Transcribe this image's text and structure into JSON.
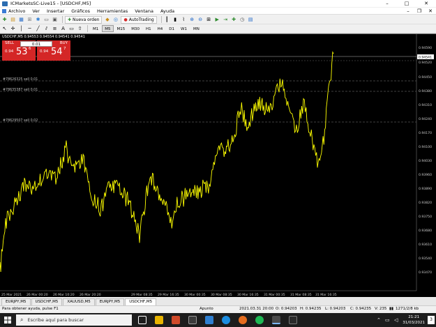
{
  "window": {
    "title": "ICMarketsSC-Live15 - [USDCHF,M5]"
  },
  "menu": {
    "items": [
      "Archivo",
      "Ver",
      "Insertar",
      "Gráficos",
      "Herramientas",
      "Ventana",
      "Ayuda"
    ]
  },
  "toolbar": {
    "new_order": "Nueva orden",
    "autotrading": "AutoTrading"
  },
  "timeframes": [
    "M1",
    "M5",
    "M15",
    "M30",
    "H1",
    "H4",
    "D1",
    "W1",
    "MN"
  ],
  "chart": {
    "header": "USDCHF,M5  0.94553 0.94554 0.94541 0.94541",
    "colors": {
      "bg": "#000000",
      "line": "#ffff00",
      "bid": "#ffffff",
      "order": "#555555"
    },
    "orders": [
      "#78626325 sell 0.01",
      "#78635387 sell 0.01",
      "#78629507 sell 0.02"
    ],
    "price_labels": [
      "0.94590",
      "0.94541",
      "0.94520",
      "0.94450",
      "0.94380",
      "0.94310",
      "0.94240",
      "0.94170",
      "0.94100",
      "0.94030",
      "0.93960",
      "0.93890",
      "0.93820",
      "0.93750",
      "0.93680",
      "0.93610",
      "0.93540",
      "0.93470"
    ],
    "time_labels": [
      "25 Mar 2021",
      "26 Mar 00:20",
      "26 Mar 10:20",
      "26 Mar 20:20",
      "29 Mar 08:35",
      "29 Mar 16:35",
      "30 Mar 00:35",
      "30 Mar 08:35",
      "30 Mar 16:35",
      "31 Mar 00:35",
      "31 Mar 08:35",
      "31 Mar 16:35"
    ]
  },
  "one_click": {
    "sell_label": "SELL",
    "buy_label": "BUY",
    "lot": "0.01",
    "sell_prefix": "0.94",
    "sell_big": "53",
    "sell_sup": "6",
    "buy_prefix": "0.94",
    "buy_big": "54",
    "buy_sup": "7"
  },
  "tabs": [
    "EURJPY,M5",
    "USDCHF,M5",
    "XAUUSD,M5",
    "EURJPY,M5",
    "USDCHF,M5"
  ],
  "status": {
    "help": "Para obtener ayuda, pulse F1",
    "profile": "Apunto",
    "datetime": "2021.03.31 20:00",
    "open": "O: 0.94203",
    "high": "H: 0.94235",
    "low": "L: 0.94203",
    "close": "C: 0.94235",
    "volume": "V: 235",
    "traffic": "1271/2/8 kb"
  },
  "taskbar": {
    "search": "Escribe aquí para buscar",
    "time": "21:21",
    "date": "31/03/2021",
    "badge": "3"
  }
}
